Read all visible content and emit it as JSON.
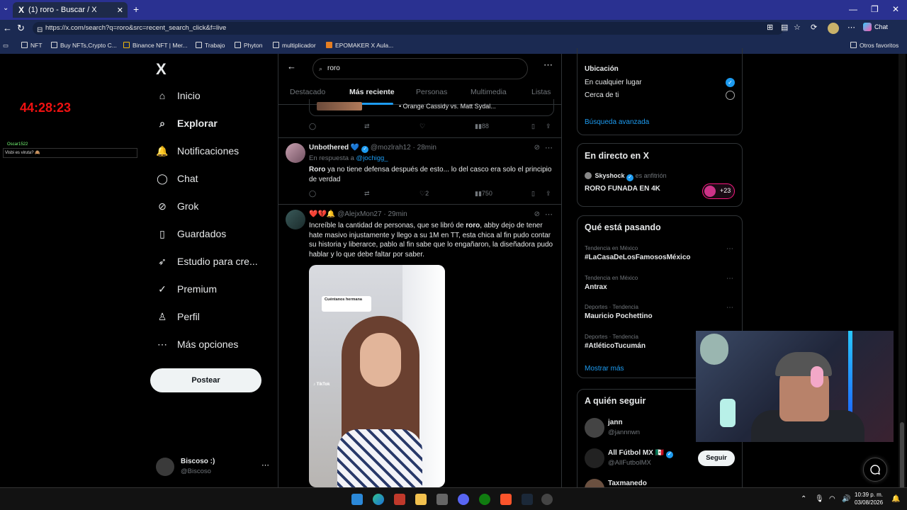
{
  "browser": {
    "tab_title": "(1) roro - Buscar / X",
    "tab_logo": "X",
    "url": "https://x.com/search?q=roro&src=recent_search_click&f=live",
    "copilot_label": "Chat",
    "bookmarks": [
      {
        "label": "NFT",
        "icon": "folder-icon"
      },
      {
        "label": "Buy NFTs,Crypto C...",
        "icon": "site-icon"
      },
      {
        "label": "Binance NFT | Mer...",
        "icon": "binance-icon"
      },
      {
        "label": "Trabajo",
        "icon": "folder-icon"
      },
      {
        "label": "Phyton",
        "icon": "folder-icon"
      },
      {
        "label": "multiplicador",
        "icon": "site-icon"
      },
      {
        "label": "EPOMAKER X Aula...",
        "icon": "site-icon"
      }
    ],
    "other_favorites": "Otros favoritos"
  },
  "overlay": {
    "timer": "44:28:23",
    "chat_user": "Oscar1522",
    "chat_message": "Visbi es viruta? 🙈"
  },
  "nav": {
    "logo": "X",
    "items": [
      {
        "label": "Inicio",
        "icon": "home-icon",
        "glyph": "⌂"
      },
      {
        "label": "Explorar",
        "icon": "search-icon",
        "glyph": "⌕"
      },
      {
        "label": "Notificaciones",
        "icon": "bell-icon",
        "glyph": "🔔"
      },
      {
        "label": "Chat",
        "icon": "chat-icon",
        "glyph": "◯"
      },
      {
        "label": "Grok",
        "icon": "grok-icon",
        "glyph": "⊘"
      },
      {
        "label": "Guardados",
        "icon": "bookmark-icon",
        "glyph": "▯"
      },
      {
        "label": "Estudio para cre...",
        "icon": "rocket-icon",
        "glyph": "➶"
      },
      {
        "label": "Premium",
        "icon": "premium-icon",
        "glyph": "✓"
      },
      {
        "label": "Perfil",
        "icon": "person-icon",
        "glyph": "♙"
      },
      {
        "label": "Más opciones",
        "icon": "more-circle-icon",
        "glyph": "⋯"
      }
    ],
    "post_button": "Postear",
    "account_name": "Biscoso :)",
    "account_handle": "@Biscoso"
  },
  "search": {
    "query": "roro",
    "tabs": [
      "Destacado",
      "Más reciente",
      "Personas",
      "Multimedia",
      "Listas"
    ],
    "active_tab": "Más reciente"
  },
  "feed": {
    "quoted_text": "• Orange Cassidy vs. Matt Sydal...",
    "prev_tweet_views": "88",
    "tweets": [
      {
        "name": "Unbothered 💙",
        "handle": "@mozlrah12",
        "time": "28min",
        "reply_prefix": "En respuesta a",
        "reply_to": "@jochigg_",
        "text_bold": "Roro",
        "text": " ya no tiene defensa después de esto... lo del casco era solo el principio de verdad",
        "likes": "2",
        "views": "750"
      },
      {
        "name": "❤️💔🔔",
        "handle": "@AlejxMon27",
        "time": "29min",
        "text_pre": "Increíble la cantidad de personas, que se libró de ",
        "text_bold": "roro",
        "text": ", abby dejo de tener hate masivo injustamente y llego a su 1M en TT, esta chica al fin pudo contar su historia y liberarce, pablo al fin sabe que lo engañaron, la diseñadora pudo hablar y lo que debe faltar por saber.",
        "media_sticker": "Cuéntanos hermana",
        "media_watermark": "TikTok"
      }
    ]
  },
  "right": {
    "location_title": "Ubicación",
    "location_options": [
      "En cualquier lugar",
      "Cerca de ti"
    ],
    "location_selected": "En cualquier lugar",
    "advanced_search": "Búsqueda avanzada",
    "live_title": "En directo en X",
    "live_host": "Skyshock",
    "live_host_role": "es anfitrión",
    "live_stream_title": "RORO FUNADA EN 4K",
    "live_count": "+23",
    "trends_title": "Qué está pasando",
    "trends": [
      {
        "meta": "Tendencia en México",
        "name": "#LaCasaDeLosFamososMéxico"
      },
      {
        "meta": "Tendencia en México",
        "name": "Antrax"
      },
      {
        "meta": "Deportes · Tendencia",
        "name": "Mauricio Pochettino"
      },
      {
        "meta": "Deportes · Tendencia",
        "name": "#AtléticoTucumán"
      }
    ],
    "show_more": "Mostrar más",
    "follow_title": "A quién seguir",
    "follow": [
      {
        "name": "jann",
        "handle": "@jannnwn"
      },
      {
        "name": "All Fútbol MX 🇲🇽",
        "handle": "@AllFutbolMX",
        "button": "Seguir"
      },
      {
        "name": "Taxmanedo",
        "handle": ""
      }
    ]
  },
  "taskbar": {
    "time": "10:39 p. m.",
    "date": "03/08/2026"
  },
  "colors": {
    "accent": "#1d9bf0",
    "background": "#000000",
    "browser_chrome": "#2a3191",
    "timer": "#e11111"
  }
}
